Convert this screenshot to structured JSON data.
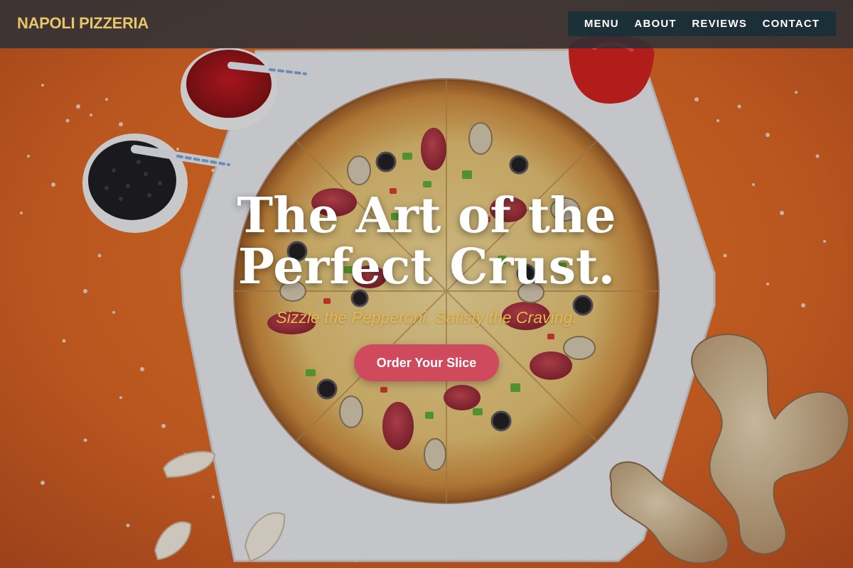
{
  "header": {
    "brand": "NAPOLI PIZZERIA",
    "nav": [
      {
        "label": "MENU"
      },
      {
        "label": "ABOUT"
      },
      {
        "label": "REVIEWS"
      },
      {
        "label": "CONTACT"
      }
    ]
  },
  "hero": {
    "headline": "The Art of the Perfect Crust.",
    "tagline": "Sizzle the Pepperoni. Satisfy the Craving.",
    "cta_label": "Order Your Slice"
  },
  "colors": {
    "brand": "#e8c46a",
    "tagline": "#e8b84f",
    "cta": "#cf4a5c",
    "header_bg": "#263038",
    "nav_bg": "#122e3a",
    "hero_bg": "#d8631f"
  },
  "icons": {
    "hero_image": "pizza-photo"
  }
}
